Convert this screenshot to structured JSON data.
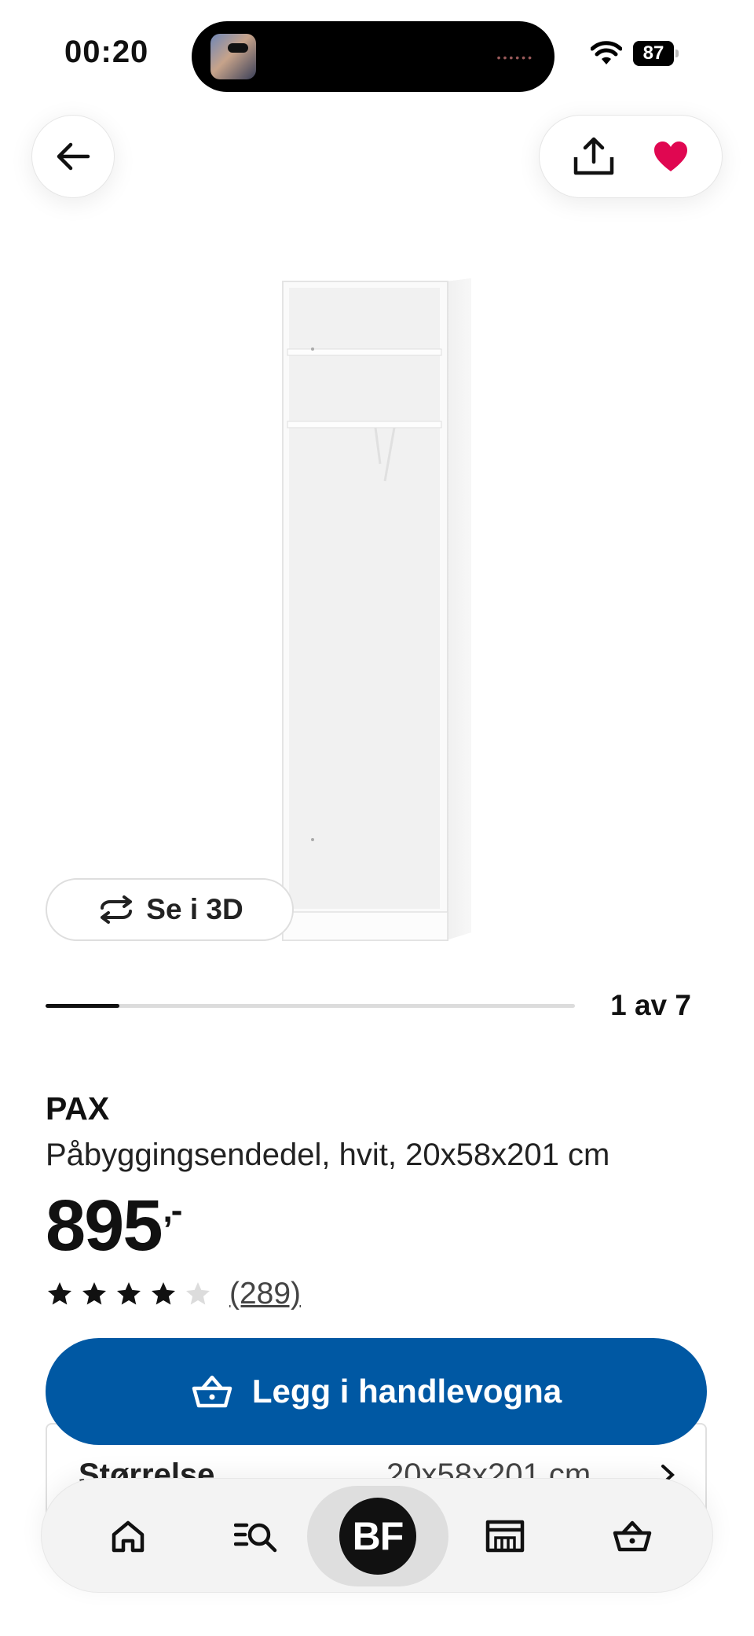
{
  "status_bar": {
    "time": "00:20",
    "battery": "87"
  },
  "icons": {
    "back": "arrow-left-icon",
    "share": "share-icon",
    "favorite": "heart-icon",
    "rotate": "rotate-3d-icon",
    "cart": "basket-icon",
    "home": "home-icon",
    "search": "search-list-icon",
    "store": "store-icon"
  },
  "colors": {
    "primary": "#0058a3",
    "favorite": "#e00751"
  },
  "gallery": {
    "view_3d_label": "Se i 3D",
    "current_index": 1,
    "total": 7,
    "page_label": "1 av 7",
    "progress": 0.14
  },
  "product": {
    "brand": "PAX",
    "description": "Påbyggingsendedel, hvit, 20x58x201 cm",
    "price": "895",
    "price_suffix": ",-",
    "rating": 4,
    "rating_max": 5,
    "review_count": "(289)"
  },
  "actions": {
    "add_to_cart": "Legg i handlevogna"
  },
  "size": {
    "label": "Størrelse",
    "value": "20x58x201 cm"
  },
  "nav": {
    "bf_label": "BF"
  }
}
